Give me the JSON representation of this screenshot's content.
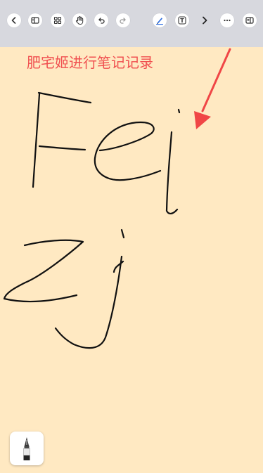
{
  "toolbar": {
    "buttons": [
      {
        "name": "back",
        "icon": "chevron-left-icon"
      },
      {
        "name": "sidebar",
        "icon": "sidebar-icon"
      },
      {
        "name": "grid",
        "icon": "grid-icon"
      },
      {
        "name": "hand",
        "icon": "hand-icon"
      },
      {
        "name": "undo",
        "icon": "undo-icon"
      },
      {
        "name": "redo",
        "icon": "redo-icon"
      },
      {
        "name": "pen",
        "icon": "pen-icon"
      },
      {
        "name": "text",
        "icon": "text-box-icon"
      },
      {
        "name": "next",
        "icon": "chevron-right-icon"
      },
      {
        "name": "more",
        "icon": "more-icon"
      },
      {
        "name": "reader",
        "icon": "reader-icon"
      }
    ],
    "text_tool_glyph": "T"
  },
  "note": {
    "title": "肥宅姬进行笔记记录",
    "title_color": "#F05050",
    "background_color": "#FFE9C2",
    "handwriting_lines": [
      "Fei",
      "Zj"
    ],
    "annotation_arrow_color": "#F04646"
  },
  "tool": {
    "current": "fountain-pen-icon"
  }
}
